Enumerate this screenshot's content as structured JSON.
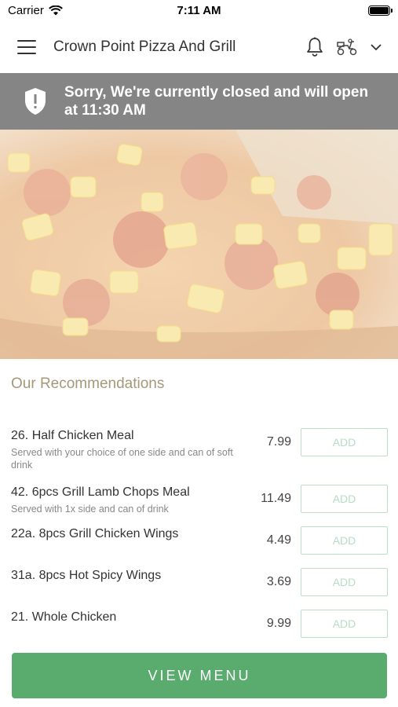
{
  "status_bar": {
    "carrier": "Carrier",
    "time": "7:11 AM"
  },
  "header": {
    "title": "Crown Point Pizza And Grill",
    "menu_icon": "hamburger-menu-icon",
    "bell_icon": "bell-icon",
    "delivery_icon": "scooter-icon",
    "dropdown_icon": "chevron-down-icon"
  },
  "banner": {
    "line1": "Sorry, We're currently closed and will open",
    "line2": "at 11:30 AM",
    "icon": "shield-alert-icon"
  },
  "recommendations": {
    "title": "Our Recommendations",
    "items": [
      {
        "name": "26. Half Chicken Meal",
        "desc": "Served with your choice of one side and can of soft drink",
        "price": "7.99",
        "button": "ADD"
      },
      {
        "name": "42. 6pcs Grill Lamb Chops Meal",
        "desc": "Served with 1x side and can of drink",
        "price": "11.49",
        "button": "ADD"
      },
      {
        "name": "22a. 8pcs Grill Chicken Wings",
        "desc": "",
        "price": "4.49",
        "button": "ADD"
      },
      {
        "name": "31a. 8pcs Hot Spicy Wings",
        "desc": "",
        "price": "3.69",
        "button": "ADD"
      },
      {
        "name": "21. Whole Chicken",
        "desc": "",
        "price": "9.99",
        "button": "ADD"
      }
    ]
  },
  "footer": {
    "view_menu_label": "VIEW MENU"
  },
  "colors": {
    "banner": "#858585",
    "accent_green": "#5aab6e",
    "add_border": "#b9e0c7",
    "rec_title": "#a6977a"
  }
}
